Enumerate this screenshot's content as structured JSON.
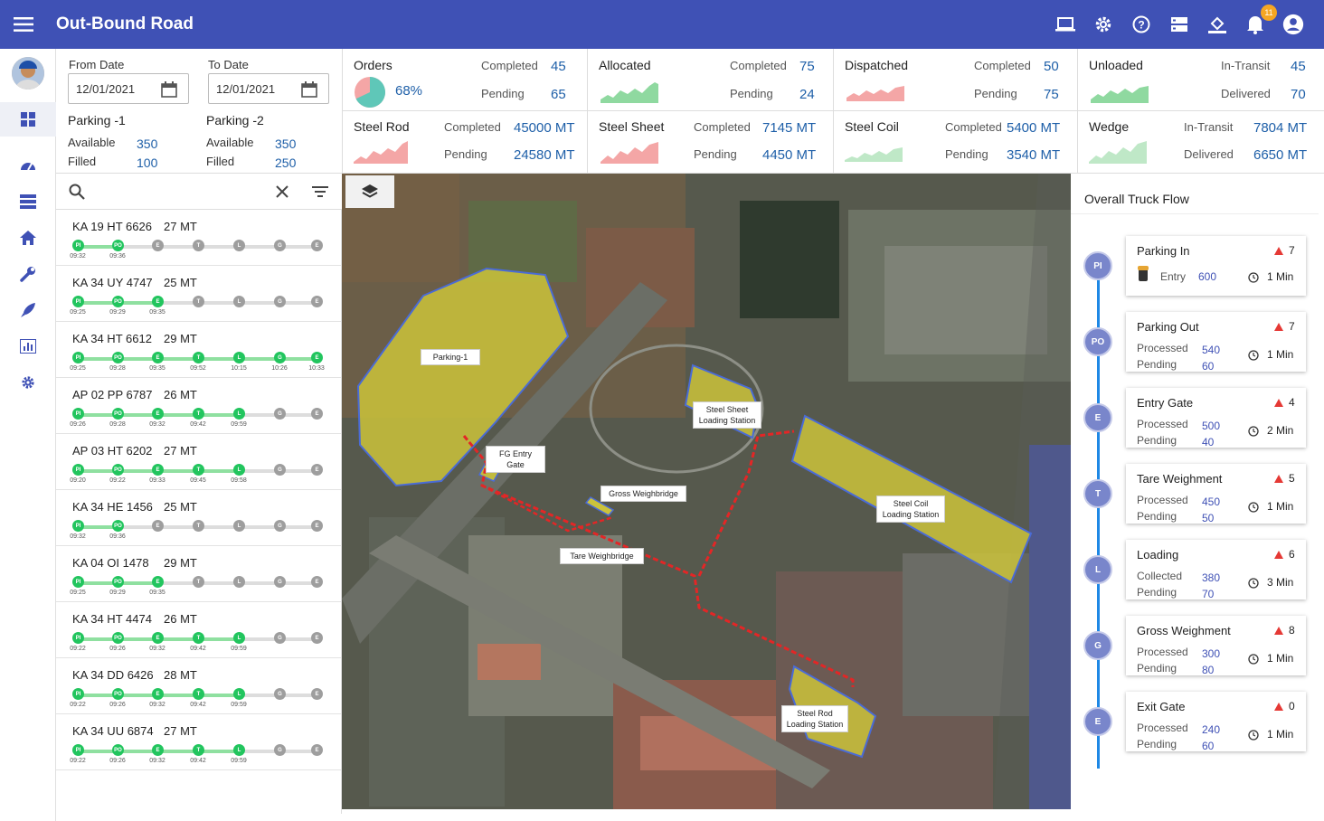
{
  "app": {
    "title": "Out-Bound Road",
    "notifications": "11"
  },
  "filters": {
    "from_label": "From Date",
    "from_value": "12/01/2021",
    "to_label": "To Date",
    "to_value": "12/01/2021",
    "parking1": {
      "title": "Parking -1",
      "available_label": "Available",
      "available": "350",
      "filled_label": "Filled",
      "filled": "100"
    },
    "parking2": {
      "title": "Parking -2",
      "available_label": "Available",
      "available": "350",
      "filled_label": "Filled",
      "filled": "250"
    }
  },
  "stats": {
    "orders": {
      "title": "Orders",
      "percent": "68%",
      "percent_value": 68,
      "l1": "Completed",
      "v1": "45",
      "l2": "Pending",
      "v2": "65"
    },
    "allocated": {
      "title": "Allocated",
      "l1": "Completed",
      "v1": "75",
      "l2": "Pending",
      "v2": "24"
    },
    "dispatched": {
      "title": "Dispatched",
      "l1": "Completed",
      "v1": "50",
      "l2": "Pending",
      "v2": "75"
    },
    "unloaded": {
      "title": "Unloaded",
      "l1": "In-Transit",
      "v1": "45",
      "l2": "Delivered",
      "v2": "70"
    },
    "steel_rod": {
      "title": "Steel Rod",
      "l1": "Completed",
      "v1": "45000 MT",
      "l2": "Pending",
      "v2": "24580 MT"
    },
    "steel_sheet": {
      "title": "Steel Sheet",
      "l1": "Completed",
      "v1": "7145 MT",
      "l2": "Pending",
      "v2": "4450 MT"
    },
    "steel_coil": {
      "title": "Steel Coil",
      "l1": "Completed",
      "v1": "5400 MT",
      "l2": "Pending",
      "v2": "3540 MT"
    },
    "wedge": {
      "title": "Wedge",
      "l1": "In-Transit",
      "v1": "7804 MT",
      "l2": "Delivered",
      "v2": "6650 MT"
    }
  },
  "colors": {
    "primary": "#3f51b5",
    "success": "#22c55e",
    "value_blue": "#1e5fa8",
    "alert": "#e53935",
    "spark_green": "#8fd9a0",
    "spark_red": "#f4a6a6"
  },
  "stage_codes": [
    "PI",
    "PO",
    "E",
    "T",
    "L",
    "G",
    "E"
  ],
  "trucks": [
    {
      "plate": "KA 19 HT 6626",
      "weight": "27 MT",
      "done": 2,
      "times": [
        "09:32",
        "09:36"
      ]
    },
    {
      "plate": "KA 34 UY 4747",
      "weight": "25 MT",
      "done": 3,
      "times": [
        "09:25",
        "09:29",
        "09:35"
      ]
    },
    {
      "plate": "KA 34 HT 6612",
      "weight": "29 MT",
      "done": 7,
      "times": [
        "09:25",
        "09:28",
        "09:35",
        "09:52",
        "10:15",
        "10:26",
        "10:33"
      ]
    },
    {
      "plate": "AP 02 PP 6787",
      "weight": "26 MT",
      "done": 5,
      "times": [
        "09:26",
        "09:28",
        "09:32",
        "09:42",
        "09:59"
      ]
    },
    {
      "plate": "AP 03 HT 6202",
      "weight": "27 MT",
      "done": 5,
      "times": [
        "09:20",
        "09:22",
        "09:33",
        "09:45",
        "09:58"
      ]
    },
    {
      "plate": "KA 34 HE 1456",
      "weight": "25 MT",
      "done": 2,
      "times": [
        "09:32",
        "09:36"
      ]
    },
    {
      "plate": "KA 04 OI 1478",
      "weight": "29 MT",
      "done": 3,
      "times": [
        "09:25",
        "09:29",
        "09:35"
      ]
    },
    {
      "plate": "KA 34 HT 4474",
      "weight": "26 MT",
      "done": 5,
      "times": [
        "09:22",
        "09:26",
        "09:32",
        "09:42",
        "09:59"
      ]
    },
    {
      "plate": "KA 34 DD 6426",
      "weight": "28 MT",
      "done": 5,
      "times": [
        "09:22",
        "09:26",
        "09:32",
        "09:42",
        "09:59"
      ]
    },
    {
      "plate": "KA 34 UU 6874",
      "weight": "27 MT",
      "done": 5,
      "times": [
        "09:22",
        "09:26",
        "09:32",
        "09:42",
        "09:59"
      ]
    }
  ],
  "map_labels": {
    "parking1": "Parking-1",
    "fg_entry": "FG Entry Gate",
    "gross_wb": "Gross Weighbridge",
    "tare_wb": "Tare Weighbridge",
    "sheet_ls": "Steel Sheet Loading Station",
    "coil_ls": "Steel Coil Loading Station",
    "rod_ls": "Steel Rod Loading Station"
  },
  "flow": {
    "title": "Overall Truck Flow",
    "steps": [
      {
        "code": "PI",
        "name": "Parking In",
        "count": "7",
        "l1": "Entry",
        "v1": "600",
        "l2": "",
        "v2": "",
        "dur": "1 Min"
      },
      {
        "code": "PO",
        "name": "Parking Out",
        "count": "7",
        "l1": "Processed",
        "v1": "540",
        "l2": "Pending",
        "v2": "60",
        "dur": "1 Min"
      },
      {
        "code": "E",
        "name": "Entry Gate",
        "count": "4",
        "l1": "Processed",
        "v1": "500",
        "l2": "Pending",
        "v2": "40",
        "dur": "2 Min"
      },
      {
        "code": "T",
        "name": "Tare Weighment",
        "count": "5",
        "l1": "Processed",
        "v1": "450",
        "l2": "Pending",
        "v2": "50",
        "dur": "1 Min"
      },
      {
        "code": "L",
        "name": "Loading",
        "count": "6",
        "l1": "Collected",
        "v1": "380",
        "l2": "Pending",
        "v2": "70",
        "dur": "3 Min"
      },
      {
        "code": "G",
        "name": "Gross  Weighment",
        "count": "8",
        "l1": "Processed",
        "v1": "300",
        "l2": "Pending",
        "v2": "80",
        "dur": "1 Min"
      },
      {
        "code": "E",
        "name": "Exit Gate",
        "count": "0",
        "l1": "Processed",
        "v1": "240",
        "l2": "Pending",
        "v2": "60",
        "dur": "1 Min"
      }
    ]
  }
}
